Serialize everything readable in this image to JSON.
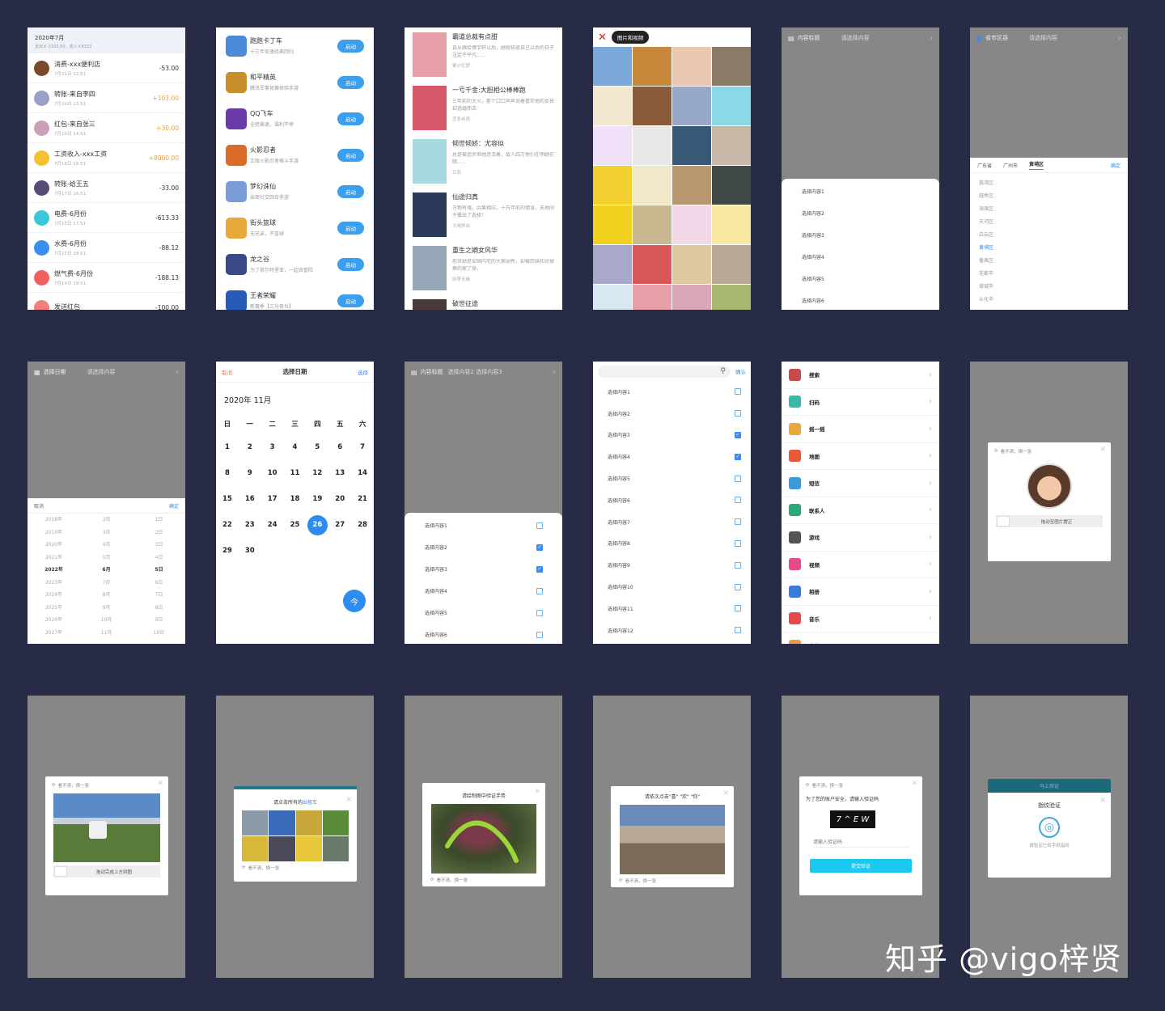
{
  "bill": {
    "month": "2020年7月",
    "summary": "支出￥-1103.50，收入￥8133",
    "rows": [
      {
        "name": "消费-xxx便利店",
        "date": "7月21日 12:51",
        "amount": "-53.00",
        "color": "#7b4a2a"
      },
      {
        "name": "转账-来自李四",
        "date": "7月20日 13:51",
        "amount": "+103.00",
        "color": "#9aa0c8"
      },
      {
        "name": "红包-来自张三",
        "date": "7月19日 14:51",
        "amount": "+30.00",
        "color": "#c8a0b8"
      },
      {
        "name": "工资收入-xxx工资",
        "date": "7月18日 15:51",
        "amount": "+8000.00",
        "color": "#f2c230"
      },
      {
        "name": "转账-给王五",
        "date": "7月17日 16:51",
        "amount": "-33.00",
        "color": "#5a4a78"
      },
      {
        "name": "电费-6月份",
        "date": "7月15日 17:51",
        "amount": "-613.33",
        "color": "#38c8d8"
      },
      {
        "name": "水费-6月份",
        "date": "7月15日 18:51",
        "amount": "-88.12",
        "color": "#3a8ef0"
      },
      {
        "name": "燃气费-6月份",
        "date": "7月14日 19:51",
        "amount": "-188.13",
        "color": "#f06060"
      },
      {
        "name": "发送红包",
        "date": "",
        "amount": "-100.00",
        "color": "#f08080"
      }
    ]
  },
  "games": {
    "button_label": "启动",
    "rows": [
      {
        "name": "跑跑卡丁车",
        "desc": "十三年竞速经典回归",
        "color": "#4a8ad8"
      },
      {
        "name": "和平精英",
        "desc": "腾讯军事竞赛体验手游",
        "color": "#c8902a"
      },
      {
        "name": "QQ飞车",
        "desc": "全民飙速，福利不停",
        "color": "#6a3aa8"
      },
      {
        "name": "火影忍者",
        "desc": "正版火影忍者格斗手游",
        "color": "#d86a2a"
      },
      {
        "name": "梦幻诛仙",
        "desc": "亲密社交回合手游",
        "color": "#7a9ad8"
      },
      {
        "name": "街头篮球",
        "desc": "无兄弟，不篮球",
        "color": "#e8a83a"
      },
      {
        "name": "龙之谷",
        "desc": "为了荷尔特里亚，一起去冒险",
        "color": "#3a4a88"
      },
      {
        "name": "王者荣耀",
        "desc": "新赛季【三分奇兵】",
        "color": "#2a5ab8"
      }
    ]
  },
  "books": [
    {
      "title": "霸道总裁有点甜",
      "desc": "自从嫁给傅宇轩以后，她就知道自己以后的日子注定不平凡……",
      "author": "紫沙忆梦",
      "color": "#e8a0a8"
    },
    {
      "title": "一亏千金:大胆相公棒棒跑",
      "desc": "三年前的大火，那个口口声声说着喜欢他的女孩却逃婚而去",
      "author": "恋冬丝雨",
      "color": "#d85a6a"
    },
    {
      "title": "倾世倾娇：尤容似",
      "desc": "总是被追杀但她还活着，敌人四方他们在明她在暗……",
      "author": "兰蕊",
      "color": "#a8d8e0"
    },
    {
      "title": "仙途归真",
      "desc": "万物有魂，因果相应。十万年前的错误，天地间于撒出了选择！",
      "author": "大咪熊出",
      "color": "#2a3a58"
    },
    {
      "title": "重生之嫡女风华",
      "desc": "前世她是安国内宅的大家闺秀，却被庶妹和对掉换的家了身。",
      "author": "妖孽无缘",
      "color": "#98a8b8"
    },
    {
      "title": "破世征途",
      "desc": "",
      "author": "",
      "color": "#4a3a3a"
    }
  ],
  "media": {
    "chip_label": "图片和视频",
    "cells": [
      "#7aa8d8",
      "#c88a3a",
      "#e8c8b0",
      "#8a7a6a",
      "#f2e8d0",
      "#8a5a3a",
      "#98a8c8",
      "#8ad8e8",
      "#f0e0f8",
      "#e8e8e8",
      "#385878",
      "#c8b8a8",
      "#f2d030",
      "#f0e8c8",
      "#b89870",
      "#404848",
      "#f2d020",
      "#c8b890",
      "#f0d8e8",
      "#f8e8a0",
      "#a8a8c8",
      "#d85858",
      "#e0c8a0",
      "#b8a898",
      "#d8e8f0",
      "#e8a0a8",
      "#d8a8b8",
      "#a8b870"
    ]
  },
  "cascade": {
    "title": "内容标题",
    "placeholder": "请选择内容",
    "options": [
      "选择内容1",
      "选择内容2",
      "选择内容3",
      "选择内容4",
      "选择内容5",
      "选择内容6"
    ]
  },
  "region": {
    "title": "省市区县",
    "placeholder": "请选择内容",
    "tabs": [
      "广东省",
      "广州市",
      "黄埔区"
    ],
    "confirm": "确定",
    "districts": [
      "荔湾区",
      "越秀区",
      "海珠区",
      "天河区",
      "白云区",
      "黄埔区",
      "番禺区",
      "花都市",
      "增城市",
      "从化市"
    ],
    "selected_index": 5
  },
  "date_wheel": {
    "title": "选择日期",
    "placeholder": "请选择内容",
    "cancel": "取消",
    "confirm": "确定",
    "years": [
      "2018年",
      "2019年",
      "2020年",
      "2021年",
      "2022年",
      "2023年",
      "2024年",
      "2025年",
      "2026年",
      "2027年"
    ],
    "months": [
      "2月",
      "3月",
      "4月",
      "5月",
      "6月",
      "7月",
      "8月",
      "9月",
      "10月",
      "11月"
    ],
    "days": [
      "1日",
      "2日",
      "3日",
      "4日",
      "5日",
      "6日",
      "7日",
      "8日",
      "9日",
      "10日"
    ],
    "selected_index": 4
  },
  "calendar": {
    "cancel": "取消",
    "title": "选择日期",
    "confirm": "选择",
    "month": "2020年 11月",
    "weekdays": [
      "日",
      "一",
      "二",
      "三",
      "四",
      "五",
      "六"
    ],
    "days": [
      "1",
      "2",
      "3",
      "4",
      "5",
      "6",
      "7",
      "8",
      "9",
      "10",
      "11",
      "12",
      "13",
      "14",
      "15",
      "16",
      "17",
      "18",
      "19",
      "20",
      "21",
      "22",
      "23",
      "24",
      "25",
      "26",
      "27",
      "28",
      "29",
      "30"
    ],
    "today": "26",
    "today_button": "今"
  },
  "multi": {
    "title": "内容标题",
    "value": "选择内容2 选择内容3",
    "options": [
      {
        "label": "选择内容1",
        "checked": false
      },
      {
        "label": "选择内容2",
        "checked": true
      },
      {
        "label": "选择内容3",
        "checked": true
      },
      {
        "label": "选择内容4",
        "checked": false
      },
      {
        "label": "选择内容5",
        "checked": false
      },
      {
        "label": "选择内容6",
        "checked": false
      }
    ]
  },
  "search_list": {
    "confirm": "确认",
    "options": [
      {
        "label": "选择内容1",
        "checked": false
      },
      {
        "label": "选择内容2",
        "checked": false
      },
      {
        "label": "选择内容3",
        "checked": true
      },
      {
        "label": "选择内容4",
        "checked": true
      },
      {
        "label": "选择内容5",
        "checked": false
      },
      {
        "label": "选择内容6",
        "checked": false
      },
      {
        "label": "选择内容7",
        "checked": false
      },
      {
        "label": "选择内容8",
        "checked": false
      },
      {
        "label": "选择内容9",
        "checked": false
      },
      {
        "label": "选择内容10",
        "checked": false
      },
      {
        "label": "选择内容11",
        "checked": false
      },
      {
        "label": "选择内容12",
        "checked": false
      }
    ]
  },
  "menu": [
    {
      "label": "搜索",
      "icon": "search-icon",
      "color": "#c84a4a"
    },
    {
      "label": "扫码",
      "icon": "scan-icon",
      "color": "#38b8a8"
    },
    {
      "label": "摇一摇",
      "icon": "shake-icon",
      "color": "#e8a83a"
    },
    {
      "label": "地图",
      "icon": "map-icon",
      "color": "#e85a3a"
    },
    {
      "label": "短信",
      "icon": "sms-icon",
      "color": "#3a9ad8"
    },
    {
      "label": "联系人",
      "icon": "contacts-icon",
      "color": "#2aa87a"
    },
    {
      "label": "游戏",
      "icon": "game-icon",
      "color": "#555555"
    },
    {
      "label": "视频",
      "icon": "video-icon",
      "color": "#e84a8a"
    },
    {
      "label": "相册",
      "icon": "album-icon",
      "color": "#3a7ad8"
    },
    {
      "label": "音乐",
      "icon": "music-icon",
      "color": "#e84a4a"
    },
    {
      "label": "应用",
      "icon": "app-icon",
      "color": "#e8a03a"
    }
  ],
  "rotate_verify": {
    "tip": "看不清，换一张",
    "slider": "拖动至图片摆正"
  },
  "puzzle_verify": {
    "tip": "看不清，换一张",
    "slider": "拖动完成上方拼图"
  },
  "select_verify": {
    "prefix": "请点击所有的",
    "keyword": "出租车",
    "tip": "看不清，换一张"
  },
  "gesture_verify": {
    "title": "请绘制图中验证手势",
    "tip": "看不清，换一张"
  },
  "word_verify": {
    "title": "请依次点击\"喜\" \"欢\" \"你\"",
    "tip": "看不清，换一张"
  },
  "code_verify": {
    "tip": "看不清，换一张",
    "title": "为了您的账户安全，请输入验证码",
    "code": "7 ^ E W",
    "placeholder": "请输入验证码",
    "submit": "提交验证"
  },
  "finger_verify": {
    "header": "马上验证",
    "title": "指纹验证",
    "tip": "请验证已有手机指纹"
  },
  "watermark": "知乎 @vigo梓贤"
}
